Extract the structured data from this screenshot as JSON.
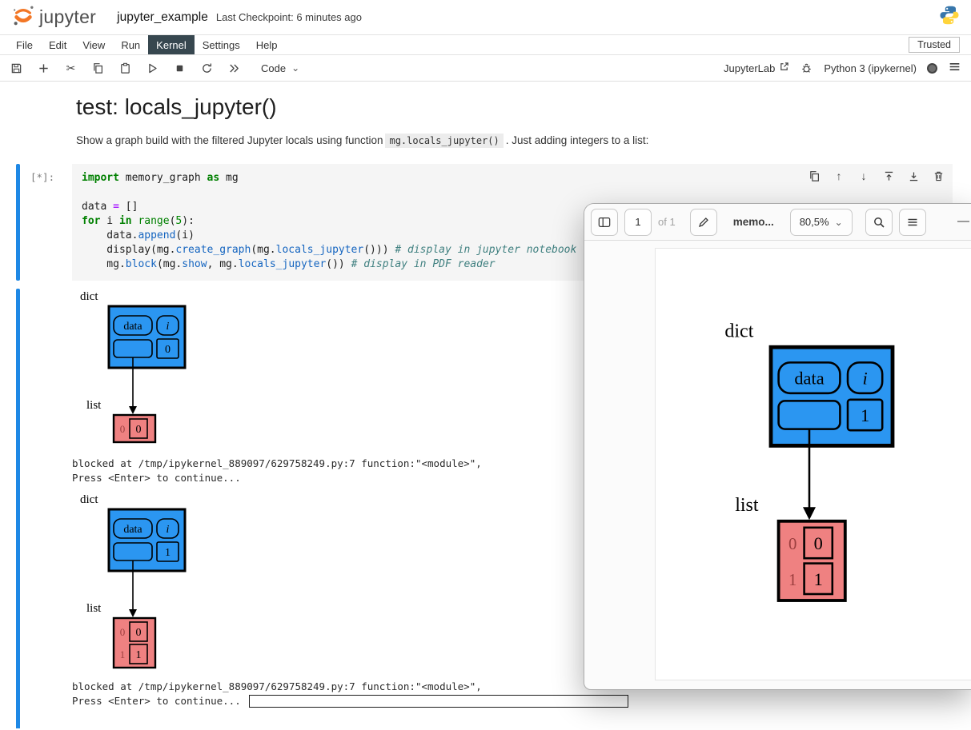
{
  "header": {
    "app_name": "jupyter",
    "notebook_title": "jupyter_example",
    "checkpoint": "Last Checkpoint: 6 minutes ago"
  },
  "menubar": {
    "items": [
      "File",
      "Edit",
      "View",
      "Run",
      "Kernel",
      "Settings",
      "Help"
    ],
    "active_item": "Kernel",
    "trusted": "Trusted"
  },
  "toolbar": {
    "cell_type_label": "Code",
    "jupyterlab_label": "JupyterLab",
    "kernel_label": "Python 3 (ipykernel)"
  },
  "markdown": {
    "heading": "test: locals_jupyter()",
    "intro_before": "Show a graph build with the filtered Jupyter locals using function",
    "intro_code": "mg.locals_jupyter()",
    "intro_after": ". Just adding integers to a list:"
  },
  "code_cell": {
    "prompt": "[*]:",
    "lines": [
      [
        {
          "t": "import",
          "c": "kw"
        },
        {
          "t": " memory_graph ",
          "c": ""
        },
        {
          "t": "as",
          "c": "kw"
        },
        {
          "t": " mg",
          "c": ""
        }
      ],
      [],
      [
        {
          "t": "data ",
          "c": ""
        },
        {
          "t": "=",
          "c": "op"
        },
        {
          "t": " []",
          "c": ""
        }
      ],
      [
        {
          "t": "for",
          "c": "kw"
        },
        {
          "t": " i ",
          "c": ""
        },
        {
          "t": "in",
          "c": "kw"
        },
        {
          "t": " ",
          "c": ""
        },
        {
          "t": "range",
          "c": "bi"
        },
        {
          "t": "(",
          "c": ""
        },
        {
          "t": "5",
          "c": "num"
        },
        {
          "t": "):",
          "c": ""
        }
      ],
      [
        {
          "t": "    data.",
          "c": ""
        },
        {
          "t": "append",
          "c": "fn"
        },
        {
          "t": "(i)",
          "c": ""
        }
      ],
      [
        {
          "t": "    display(mg.",
          "c": ""
        },
        {
          "t": "create_graph",
          "c": "fn"
        },
        {
          "t": "(mg.",
          "c": ""
        },
        {
          "t": "locals_jupyter",
          "c": "fn"
        },
        {
          "t": "())) ",
          "c": ""
        },
        {
          "t": "# display in jupyter notebook",
          "c": "cm"
        }
      ],
      [
        {
          "t": "    mg.",
          "c": ""
        },
        {
          "t": "block",
          "c": "fn"
        },
        {
          "t": "(mg.",
          "c": ""
        },
        {
          "t": "show",
          "c": "fn"
        },
        {
          "t": ", mg.",
          "c": ""
        },
        {
          "t": "locals_jupyter",
          "c": "fn"
        },
        {
          "t": "()) ",
          "c": ""
        },
        {
          "t": "# display in PDF reader",
          "c": "cm"
        }
      ]
    ]
  },
  "outputs": {
    "blocked_line": "blocked at /tmp/ipykernel_889097/629758249.py:7 function:\"<module>\",",
    "press_line": "Press <Enter> to continue..."
  },
  "graphs": {
    "g1": {
      "dict_label": "dict",
      "list_label": "list",
      "key1": "data",
      "key2": "i",
      "i_value": "0",
      "rows": [
        {
          "index": "0",
          "value": "0"
        }
      ]
    },
    "g2": {
      "dict_label": "dict",
      "list_label": "list",
      "key1": "data",
      "key2": "i",
      "i_value": "1",
      "rows": [
        {
          "index": "0",
          "value": "0"
        },
        {
          "index": "1",
          "value": "1"
        }
      ]
    },
    "pdf": {
      "dict_label": "dict",
      "list_label": "list",
      "key1": "data",
      "key2": "i",
      "i_value": "1",
      "rows": [
        {
          "index": "0",
          "value": "0"
        },
        {
          "index": "1",
          "value": "1"
        }
      ]
    }
  },
  "pdf_viewer": {
    "page_number": "1",
    "of_label": "of 1",
    "title": "memo...",
    "zoom": "80,5%"
  },
  "icons": {
    "scissors": "✂",
    "arrow_up": "↑",
    "arrow_down": "↓",
    "chevron_down": "⌄",
    "minimize": "—"
  },
  "colors": {
    "jupyter_orange": "#f37726",
    "cell_indicator_blue": "#1e88e5",
    "node_blue": "#2b96f1",
    "node_red": "#ef8181"
  }
}
